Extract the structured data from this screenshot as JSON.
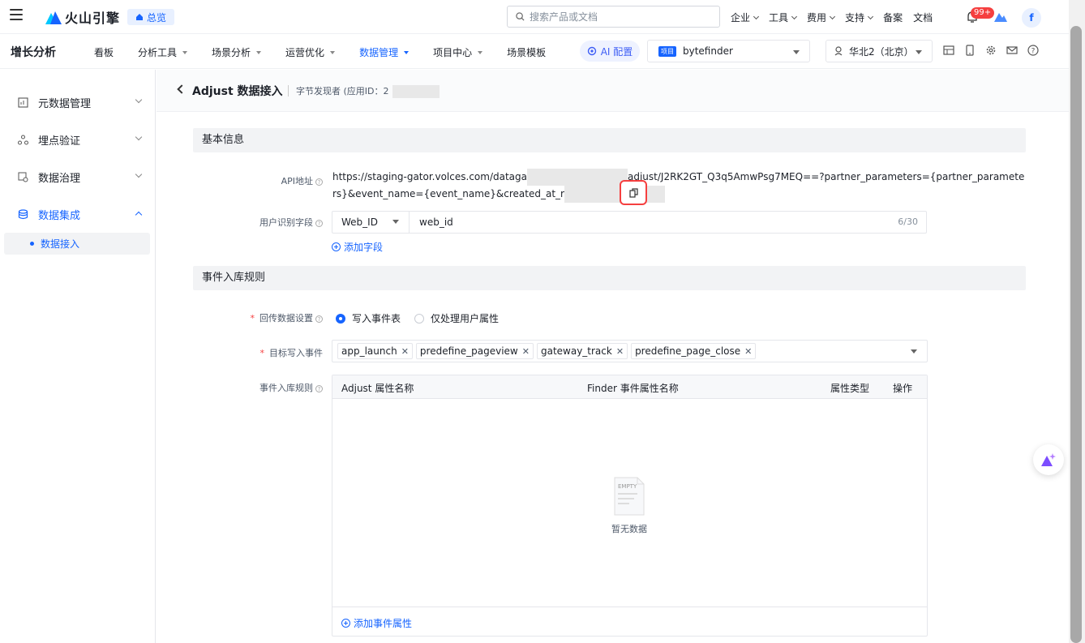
{
  "topbar": {
    "logo_text": "火山引擎",
    "overview_label": "总览",
    "search_placeholder": "搜索产品或文档",
    "nav": [
      "企业",
      "工具",
      "费用",
      "支持",
      "备案",
      "文档"
    ],
    "notification_count": "99+",
    "avatar_initial": "f"
  },
  "navbar": {
    "product": "增长分析",
    "items": [
      {
        "label": "看板",
        "has_caret": false,
        "active": false
      },
      {
        "label": "分析工具",
        "has_caret": true,
        "active": false
      },
      {
        "label": "场景分析",
        "has_caret": true,
        "active": false
      },
      {
        "label": "运营优化",
        "has_caret": true,
        "active": false
      },
      {
        "label": "数据管理",
        "has_caret": true,
        "active": true
      },
      {
        "label": "项目中心",
        "has_caret": true,
        "active": false
      },
      {
        "label": "场景模板",
        "has_caret": false,
        "active": false
      }
    ],
    "ai_label": "AI 配置",
    "project_tag": "项目",
    "project_name": "bytefinder",
    "region": "华北2（北京）"
  },
  "sidebar": {
    "items": [
      {
        "label": "元数据管理",
        "icon": "metadata-icon"
      },
      {
        "label": "埋点验证",
        "icon": "verify-icon"
      },
      {
        "label": "数据治理",
        "icon": "governance-icon"
      },
      {
        "label": "数据集成",
        "icon": "integration-icon"
      }
    ],
    "sub_item": "数据接入"
  },
  "page": {
    "title": "Adjust 数据接入",
    "subtitle": "字节发现者 (应用ID：2"
  },
  "basic": {
    "section_title": "基本信息",
    "api_label": "API地址",
    "api_part1": "https://staging-gator.volces.com/dataga",
    "api_part2": "adjust/J2RK2GT_Q3q5AmwPsg7MEQ==?partner_parameters={partner_parameters}&e",
    "api_part3": "vent_name={event_name}&created_at_r",
    "user_field_label": "用户识别字段",
    "user_field_type": "Web_ID",
    "user_field_value": "web_id",
    "user_field_count": "6/30",
    "add_field": "添加字段"
  },
  "rules": {
    "section_title": "事件入库规则",
    "callback_label": "回传数据设置",
    "radio_options": [
      "写入事件表",
      "仅处理用户属性"
    ],
    "target_label": "目标写入事件",
    "tags": [
      "app_launch",
      "predefine_pageview",
      "gateway_track",
      "predefine_page_close"
    ],
    "rule_label": "事件入库规则",
    "table_headers": [
      "Adjust 属性名称",
      "Finder 事件属性名称",
      "属性类型",
      "操作"
    ],
    "empty_text": "暂无数据",
    "add_attr": "添加事件属性"
  }
}
